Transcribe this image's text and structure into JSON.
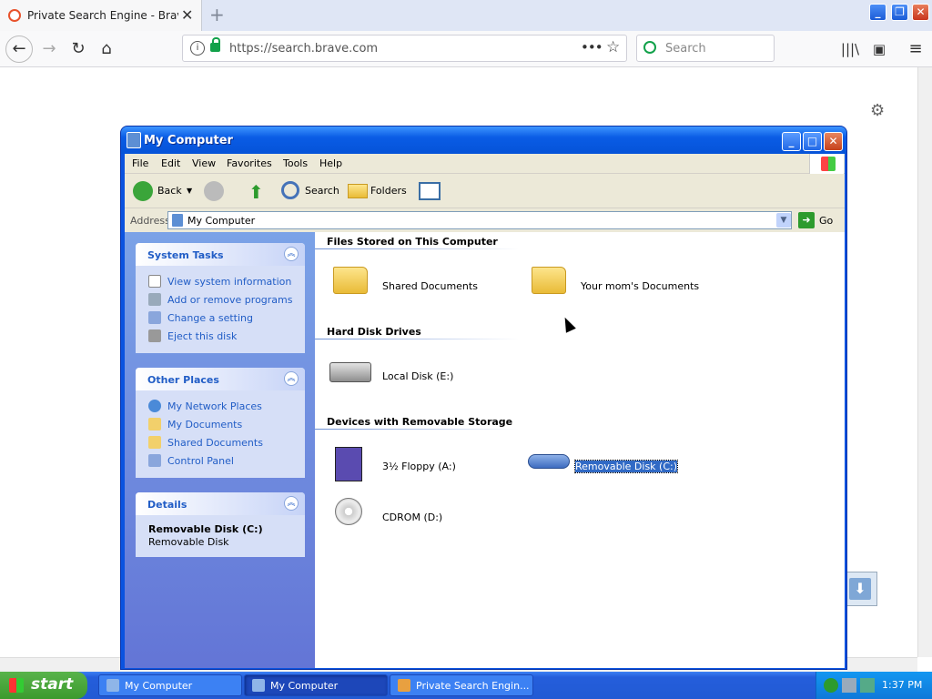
{
  "browser": {
    "tab_title": "Private Search Engine - Brave Se",
    "url": "https://search.brave.com",
    "search_placeholder": "Search"
  },
  "xp_window": {
    "title": "My Computer",
    "menu": [
      "File",
      "Edit",
      "View",
      "Favorites",
      "Tools",
      "Help"
    ],
    "toolbar": {
      "back": "Back",
      "search": "Search",
      "folders": "Folders"
    },
    "address_label": "Address",
    "address_value": "My Computer",
    "go_label": "Go",
    "tasks_panel": {
      "title": "System Tasks",
      "items": [
        "View system information",
        "Add or remove programs",
        "Change a setting",
        "Eject this disk"
      ]
    },
    "places_panel": {
      "title": "Other Places",
      "items": [
        "My Network Places",
        "My Documents",
        "Shared Documents",
        "Control Panel"
      ]
    },
    "details_panel": {
      "title": "Details",
      "name": "Removable Disk (C:)",
      "type": "Removable Disk"
    },
    "groups": {
      "files": "Files Stored on This Computer",
      "hdd": "Hard Disk Drives",
      "removable": "Devices with Removable Storage"
    },
    "items": {
      "shared_docs": "Shared Documents",
      "moms_docs": "Your mom's Documents",
      "local_disk": "Local Disk (E:)",
      "floppy": "3½ Floppy (A:)",
      "removable": "Removable Disk (C:)",
      "cdrom": "CDROM (D:)"
    }
  },
  "taskbar": {
    "start": "start",
    "tasks": [
      "My Computer",
      "My Computer",
      "Private Search Engin..."
    ],
    "time": "1:37 PM"
  }
}
